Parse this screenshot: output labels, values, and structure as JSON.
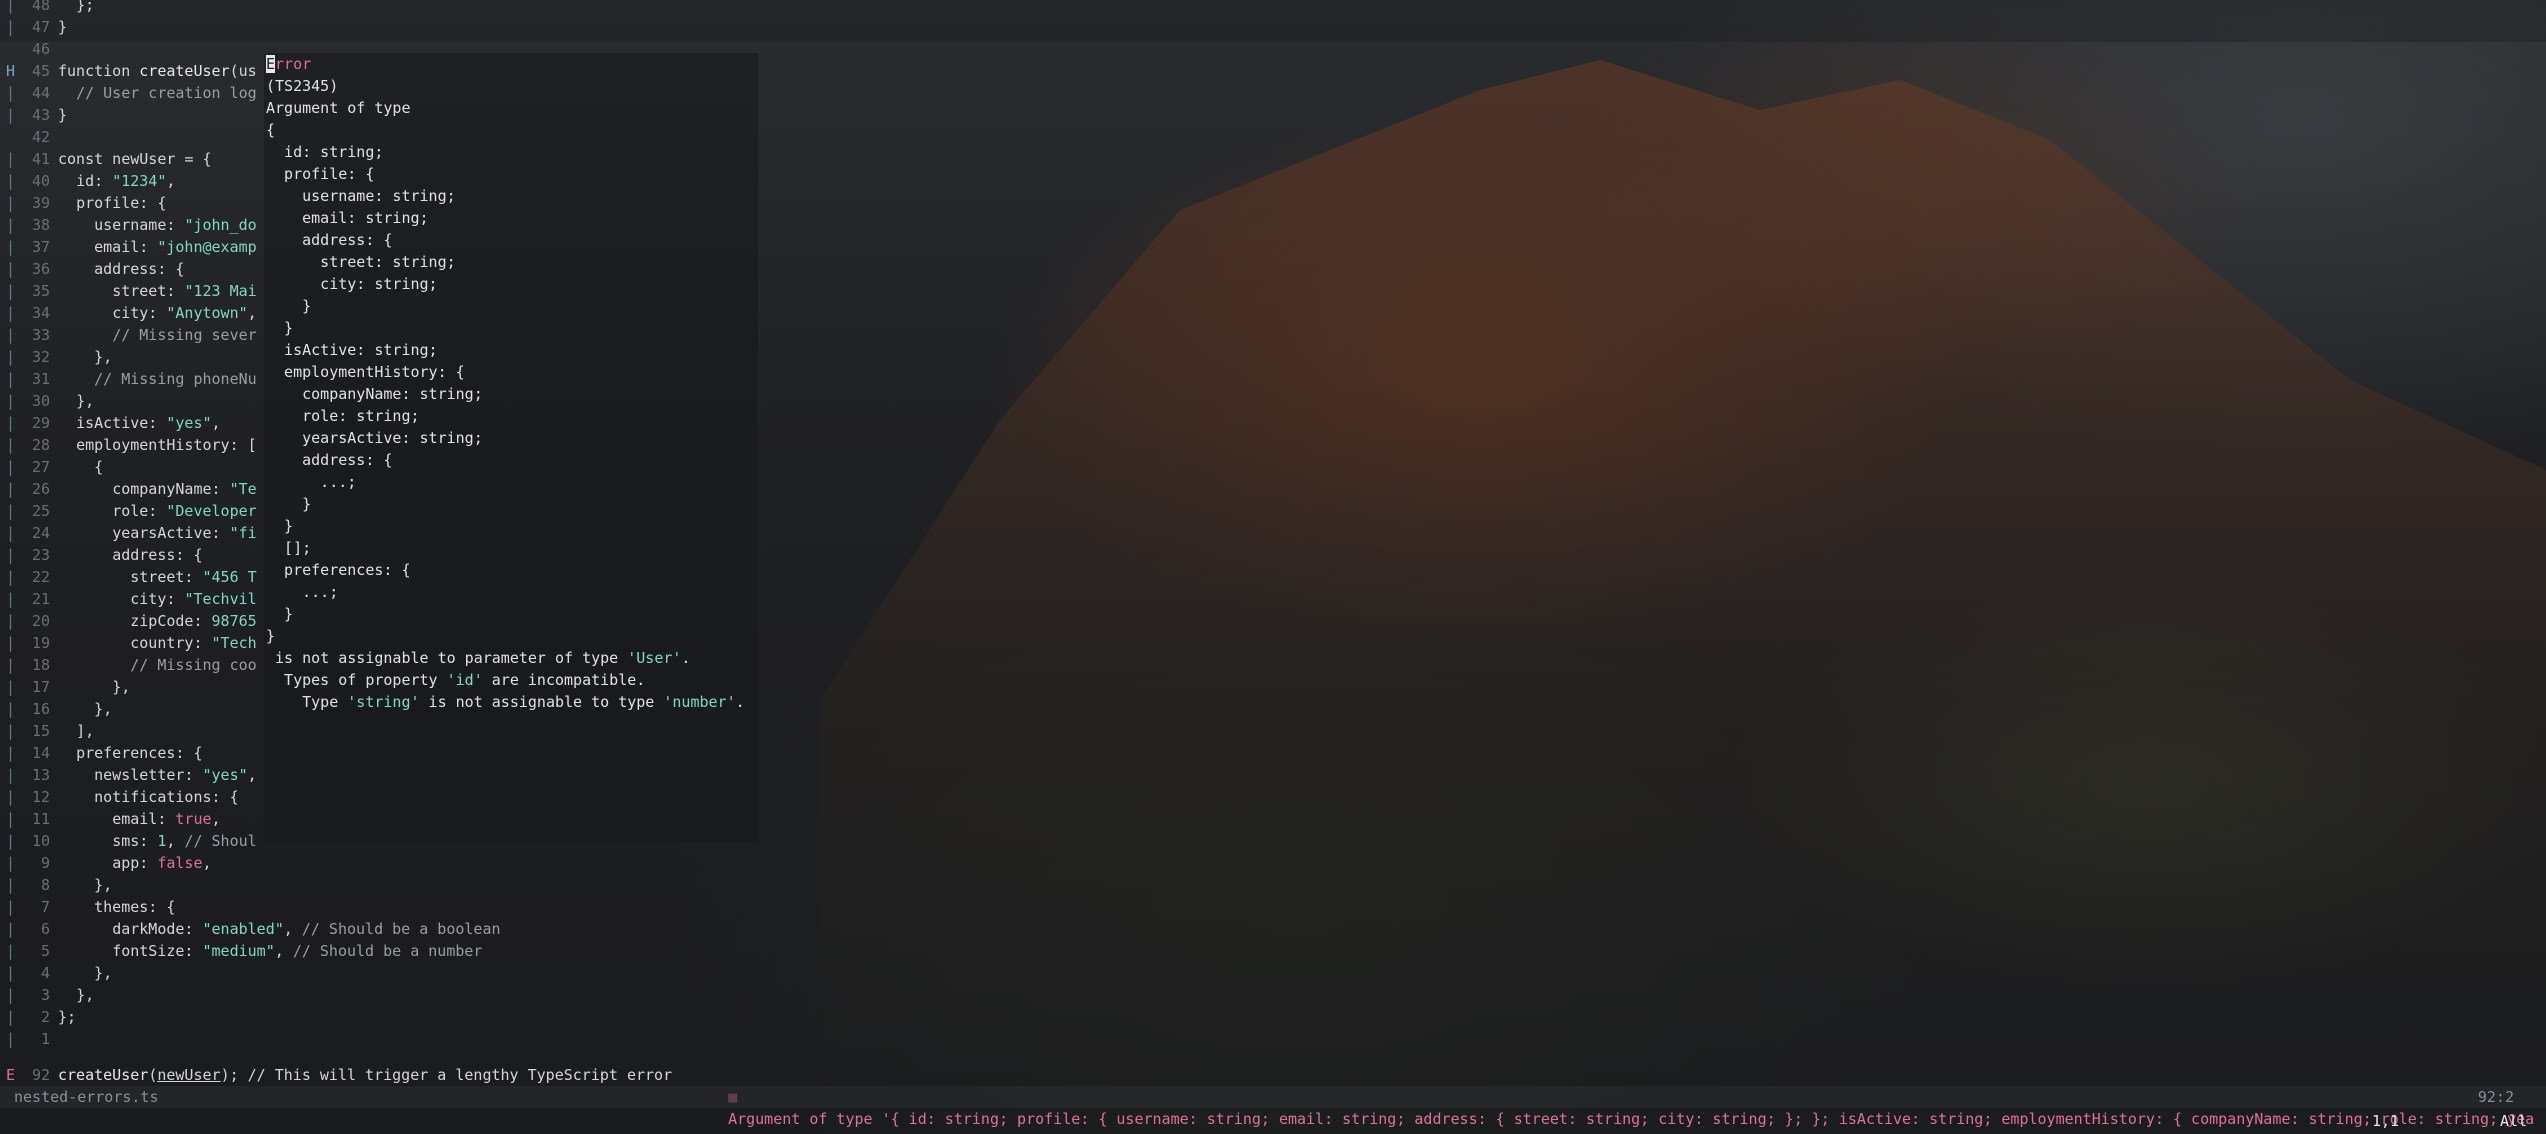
{
  "editor": {
    "file_name": "nested-errors.ts",
    "cursor_statusline": "92:2",
    "cursor_position": "1,1",
    "scroll_position": "All",
    "lines": [
      {
        "n": "48",
        "sign": "|",
        "indent": "  ",
        "tokens": [
          {
            "t": "};",
            "c": "kw"
          }
        ]
      },
      {
        "n": "47",
        "sign": "|",
        "indent": "",
        "tokens": [
          {
            "t": "}",
            "c": "kw"
          }
        ]
      },
      {
        "n": "46",
        "sign": "",
        "indent": "",
        "tokens": []
      },
      {
        "n": "45",
        "sign": "H",
        "indent": "",
        "tokens": [
          {
            "t": "function ",
            "c": "kw"
          },
          {
            "t": "createUser",
            "c": "fn"
          },
          {
            "t": "(us",
            "c": "kw"
          }
        ]
      },
      {
        "n": "44",
        "sign": "|",
        "indent": "  ",
        "tokens": [
          {
            "t": "// User creation log",
            "c": "cmt"
          }
        ]
      },
      {
        "n": "43",
        "sign": "|",
        "indent": "",
        "tokens": [
          {
            "t": "}",
            "c": "kw"
          }
        ]
      },
      {
        "n": "42",
        "sign": "",
        "indent": "",
        "tokens": []
      },
      {
        "n": "41",
        "sign": "|",
        "indent": "",
        "tokens": [
          {
            "t": "const newUser = {",
            "c": "kw"
          }
        ]
      },
      {
        "n": "40",
        "sign": "|",
        "indent": "  ",
        "tokens": [
          {
            "t": "id: ",
            "c": "kw"
          },
          {
            "t": "\"1234\"",
            "c": "str"
          },
          {
            "t": ",",
            "c": "kw"
          }
        ]
      },
      {
        "n": "39",
        "sign": "|",
        "indent": "  ",
        "tokens": [
          {
            "t": "profile: {",
            "c": "kw"
          }
        ]
      },
      {
        "n": "38",
        "sign": "|",
        "indent": "    ",
        "tokens": [
          {
            "t": "username: ",
            "c": "kw"
          },
          {
            "t": "\"john_do",
            "c": "str"
          }
        ]
      },
      {
        "n": "37",
        "sign": "|",
        "indent": "    ",
        "tokens": [
          {
            "t": "email: ",
            "c": "kw"
          },
          {
            "t": "\"john@examp",
            "c": "str"
          }
        ]
      },
      {
        "n": "36",
        "sign": "|",
        "indent": "    ",
        "tokens": [
          {
            "t": "address: {",
            "c": "kw"
          }
        ]
      },
      {
        "n": "35",
        "sign": "|",
        "indent": "      ",
        "tokens": [
          {
            "t": "street: ",
            "c": "kw"
          },
          {
            "t": "\"123 Mai",
            "c": "str"
          }
        ]
      },
      {
        "n": "34",
        "sign": "|",
        "indent": "      ",
        "tokens": [
          {
            "t": "city: ",
            "c": "kw"
          },
          {
            "t": "\"Anytown\"",
            "c": "str"
          },
          {
            "t": ",",
            "c": "kw"
          }
        ]
      },
      {
        "n": "33",
        "sign": "|",
        "indent": "      ",
        "tokens": [
          {
            "t": "// Missing sever",
            "c": "cmt"
          }
        ]
      },
      {
        "n": "32",
        "sign": "|",
        "indent": "    ",
        "tokens": [
          {
            "t": "},",
            "c": "kw"
          }
        ]
      },
      {
        "n": "31",
        "sign": "|",
        "indent": "    ",
        "tokens": [
          {
            "t": "// Missing phoneNu",
            "c": "cmt"
          }
        ]
      },
      {
        "n": "30",
        "sign": "|",
        "indent": "  ",
        "tokens": [
          {
            "t": "},",
            "c": "kw"
          }
        ]
      },
      {
        "n": "29",
        "sign": "|",
        "indent": "  ",
        "tokens": [
          {
            "t": "isActive: ",
            "c": "kw"
          },
          {
            "t": "\"yes\"",
            "c": "str"
          },
          {
            "t": ",",
            "c": "kw"
          }
        ]
      },
      {
        "n": "28",
        "sign": "|",
        "indent": "  ",
        "tokens": [
          {
            "t": "employmentHistory: [",
            "c": "kw"
          }
        ]
      },
      {
        "n": "27",
        "sign": "|",
        "indent": "    ",
        "tokens": [
          {
            "t": "{",
            "c": "kw"
          }
        ]
      },
      {
        "n": "26",
        "sign": "|",
        "indent": "      ",
        "tokens": [
          {
            "t": "companyName: ",
            "c": "kw"
          },
          {
            "t": "\"Te",
            "c": "str"
          }
        ]
      },
      {
        "n": "25",
        "sign": "|",
        "indent": "      ",
        "tokens": [
          {
            "t": "role: ",
            "c": "kw"
          },
          {
            "t": "\"Developer",
            "c": "str"
          }
        ]
      },
      {
        "n": "24",
        "sign": "|",
        "indent": "      ",
        "tokens": [
          {
            "t": "yearsActive: ",
            "c": "kw"
          },
          {
            "t": "\"fi",
            "c": "str"
          }
        ]
      },
      {
        "n": "23",
        "sign": "|",
        "indent": "      ",
        "tokens": [
          {
            "t": "address: {",
            "c": "kw"
          }
        ]
      },
      {
        "n": "22",
        "sign": "|",
        "indent": "        ",
        "tokens": [
          {
            "t": "street: ",
            "c": "kw"
          },
          {
            "t": "\"456 T",
            "c": "str"
          }
        ]
      },
      {
        "n": "21",
        "sign": "|",
        "indent": "        ",
        "tokens": [
          {
            "t": "city: ",
            "c": "kw"
          },
          {
            "t": "\"Techvil",
            "c": "str"
          }
        ]
      },
      {
        "n": "20",
        "sign": "|",
        "indent": "        ",
        "tokens": [
          {
            "t": "zipCode: ",
            "c": "kw"
          },
          {
            "t": "98765",
            "c": "numlit"
          }
        ]
      },
      {
        "n": "19",
        "sign": "|",
        "indent": "        ",
        "tokens": [
          {
            "t": "country: ",
            "c": "kw"
          },
          {
            "t": "\"Tech",
            "c": "str"
          }
        ]
      },
      {
        "n": "18",
        "sign": "|",
        "indent": "        ",
        "tokens": [
          {
            "t": "// Missing coo",
            "c": "cmt"
          }
        ]
      },
      {
        "n": "17",
        "sign": "|",
        "indent": "      ",
        "tokens": [
          {
            "t": "},",
            "c": "kw"
          }
        ]
      },
      {
        "n": "16",
        "sign": "|",
        "indent": "    ",
        "tokens": [
          {
            "t": "},",
            "c": "kw"
          }
        ]
      },
      {
        "n": "15",
        "sign": "|",
        "indent": "  ",
        "tokens": [
          {
            "t": "],",
            "c": "kw"
          }
        ]
      },
      {
        "n": "14",
        "sign": "|",
        "indent": "  ",
        "tokens": [
          {
            "t": "preferences: {",
            "c": "kw"
          }
        ]
      },
      {
        "n": "13",
        "sign": "|",
        "indent": "    ",
        "tokens": [
          {
            "t": "newsletter: ",
            "c": "kw"
          },
          {
            "t": "\"yes\"",
            "c": "str"
          },
          {
            "t": ",",
            "c": "kw"
          }
        ]
      },
      {
        "n": "12",
        "sign": "|",
        "indent": "    ",
        "tokens": [
          {
            "t": "notifications: {",
            "c": "kw"
          }
        ]
      },
      {
        "n": "11",
        "sign": "|",
        "indent": "      ",
        "tokens": [
          {
            "t": "email: ",
            "c": "kw"
          },
          {
            "t": "true",
            "c": "bool"
          },
          {
            "t": ",",
            "c": "kw"
          }
        ]
      },
      {
        "n": "10",
        "sign": "|",
        "indent": "      ",
        "tokens": [
          {
            "t": "sms: ",
            "c": "kw"
          },
          {
            "t": "1",
            "c": "numlit"
          },
          {
            "t": ", ",
            "c": "kw"
          },
          {
            "t": "// Shoul",
            "c": "cmt"
          }
        ]
      },
      {
        "n": "9",
        "sign": "|",
        "indent": "      ",
        "tokens": [
          {
            "t": "app: ",
            "c": "kw"
          },
          {
            "t": "false",
            "c": "bool"
          },
          {
            "t": ",",
            "c": "kw"
          }
        ]
      },
      {
        "n": "8",
        "sign": "|",
        "indent": "    ",
        "tokens": [
          {
            "t": "},",
            "c": "kw"
          }
        ]
      },
      {
        "n": "7",
        "sign": "|",
        "indent": "    ",
        "tokens": [
          {
            "t": "themes: {",
            "c": "kw"
          }
        ]
      },
      {
        "n": "6",
        "sign": "|",
        "indent": "      ",
        "tokens": [
          {
            "t": "darkMode: ",
            "c": "kw"
          },
          {
            "t": "\"enabled\"",
            "c": "str"
          },
          {
            "t": ", ",
            "c": "kw"
          },
          {
            "t": "// Should be a boolean",
            "c": "cmt"
          }
        ]
      },
      {
        "n": "5",
        "sign": "|",
        "indent": "      ",
        "tokens": [
          {
            "t": "fontSize: ",
            "c": "kw"
          },
          {
            "t": "\"medium\"",
            "c": "str"
          },
          {
            "t": ", ",
            "c": "kw"
          },
          {
            "t": "// Should be a number",
            "c": "cmt"
          }
        ]
      },
      {
        "n": "4",
        "sign": "|",
        "indent": "    ",
        "tokens": [
          {
            "t": "},",
            "c": "kw"
          }
        ]
      },
      {
        "n": "3",
        "sign": "|",
        "indent": "  ",
        "tokens": [
          {
            "t": "},",
            "c": "kw"
          }
        ]
      },
      {
        "n": "2",
        "sign": "|",
        "indent": "",
        "tokens": [
          {
            "t": "};",
            "c": "kw"
          }
        ]
      },
      {
        "n": "1",
        "sign": "|",
        "indent": "",
        "tokens": []
      },
      {
        "n": "92",
        "sign": "E",
        "indent": "",
        "tokens": [
          {
            "t": "createUser",
            "c": "fn"
          },
          {
            "t": "(",
            "c": "kw"
          },
          {
            "t": "newUser",
            "c": "ul"
          },
          {
            "t": "); ",
            "c": "kw"
          },
          {
            "t": "// This will trigger a lengthy TypeScript error",
            "c": "kw"
          }
        ]
      }
    ]
  },
  "popup": {
    "lines": [
      {
        "t": "Error",
        "c": "perr"
      },
      {
        "t": "(TS2345)",
        "c": ""
      },
      {
        "t": "Argument of type",
        "c": ""
      },
      {
        "t": "{",
        "c": ""
      },
      {
        "t": "  id: string;",
        "c": ""
      },
      {
        "t": "  profile: {",
        "c": ""
      },
      {
        "t": "    username: string;",
        "c": ""
      },
      {
        "t": "    email: string;",
        "c": ""
      },
      {
        "t": "    address: {",
        "c": ""
      },
      {
        "t": "      street: string;",
        "c": ""
      },
      {
        "t": "      city: string;",
        "c": ""
      },
      {
        "t": "    }",
        "c": ""
      },
      {
        "t": "  }",
        "c": ""
      },
      {
        "t": "  isActive: string;",
        "c": ""
      },
      {
        "t": "  employmentHistory: {",
        "c": ""
      },
      {
        "t": "    companyName: string;",
        "c": ""
      },
      {
        "t": "    role: string;",
        "c": ""
      },
      {
        "t": "    yearsActive: string;",
        "c": ""
      },
      {
        "t": "    address: {",
        "c": ""
      },
      {
        "t": "      ...;",
        "c": ""
      },
      {
        "t": "    }",
        "c": ""
      },
      {
        "t": "  }",
        "c": ""
      },
      {
        "t": "  [];",
        "c": ""
      },
      {
        "t": "  preferences: {",
        "c": ""
      },
      {
        "t": "    ...;",
        "c": ""
      },
      {
        "t": "  }",
        "c": ""
      },
      {
        "t": "}",
        "c": ""
      }
    ],
    "tail": [
      [
        {
          "t": " is not assignable to parameter of type ",
          "c": ""
        },
        {
          "t": "'User'",
          "c": "pgreen"
        },
        {
          "t": ".",
          "c": ""
        }
      ],
      [
        {
          "t": "  Types of property ",
          "c": ""
        },
        {
          "t": "'id'",
          "c": "pgreen"
        },
        {
          "t": " are incompatible.",
          "c": ""
        }
      ],
      [
        {
          "t": "    Type ",
          "c": ""
        },
        {
          "t": "'string'",
          "c": "pgreen"
        },
        {
          "t": " is not assignable to type ",
          "c": ""
        },
        {
          "t": "'number'",
          "c": "pgreen"
        },
        {
          "t": ".",
          "c": ""
        }
      ]
    ]
  },
  "diagnostic": {
    "marker": "■",
    "text": "Argument of type '{ id: string; profile: { username: string; email: string; address: { street: string; city: string; }; }; isActive: string; employmentHistory: { companyName: string; role: string; yea"
  },
  "colors": {
    "error": "#e0709a",
    "string": "#7fd9c3"
  }
}
